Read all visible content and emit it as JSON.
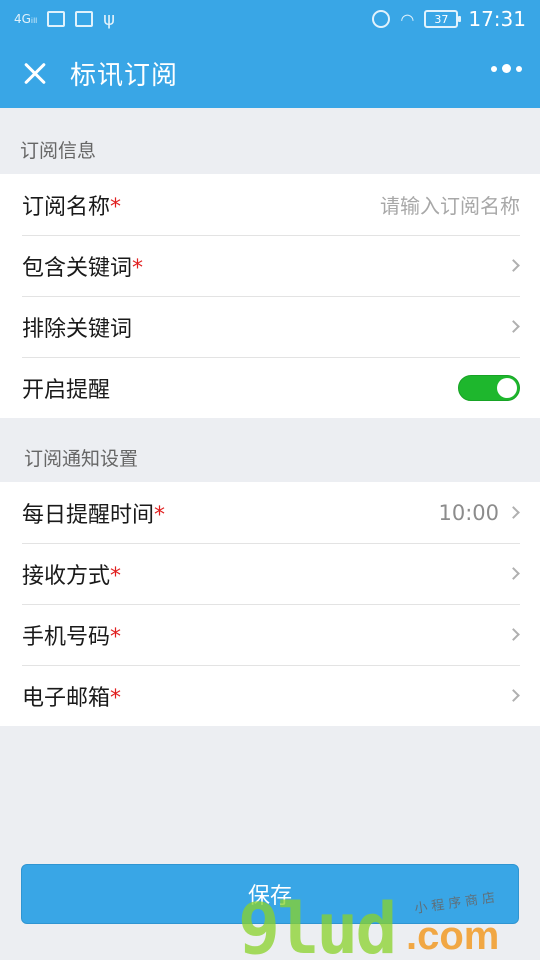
{
  "status_bar": {
    "signal": "4Gᵢₗₗ",
    "time": "17:31",
    "battery": "37"
  },
  "nav": {
    "title": "标讯订阅"
  },
  "sections": [
    {
      "header": "订阅信息",
      "rows": [
        {
          "label": "订阅名称",
          "required": "*",
          "placeholder": "请输入订阅名称"
        },
        {
          "label": "包含关键词",
          "required": "*"
        },
        {
          "label": "排除关键词"
        },
        {
          "label": "开启提醒",
          "toggle": "on"
        }
      ]
    },
    {
      "header": "订阅通知设置",
      "rows": [
        {
          "label": "每日提醒时间",
          "required": "*",
          "value": "10:00"
        },
        {
          "label": "接收方式",
          "required": "*"
        },
        {
          "label": "手机号码",
          "required": "*"
        },
        {
          "label": "电子邮箱",
          "required": "*"
        }
      ]
    }
  ],
  "save_label": "保存",
  "watermark": {
    "main": "9lud",
    "dot": ".com",
    "small": "小程序商店"
  },
  "colors": {
    "primary": "#39a6e6",
    "toggle_on": "#1eb72d",
    "required": "#e02020"
  }
}
